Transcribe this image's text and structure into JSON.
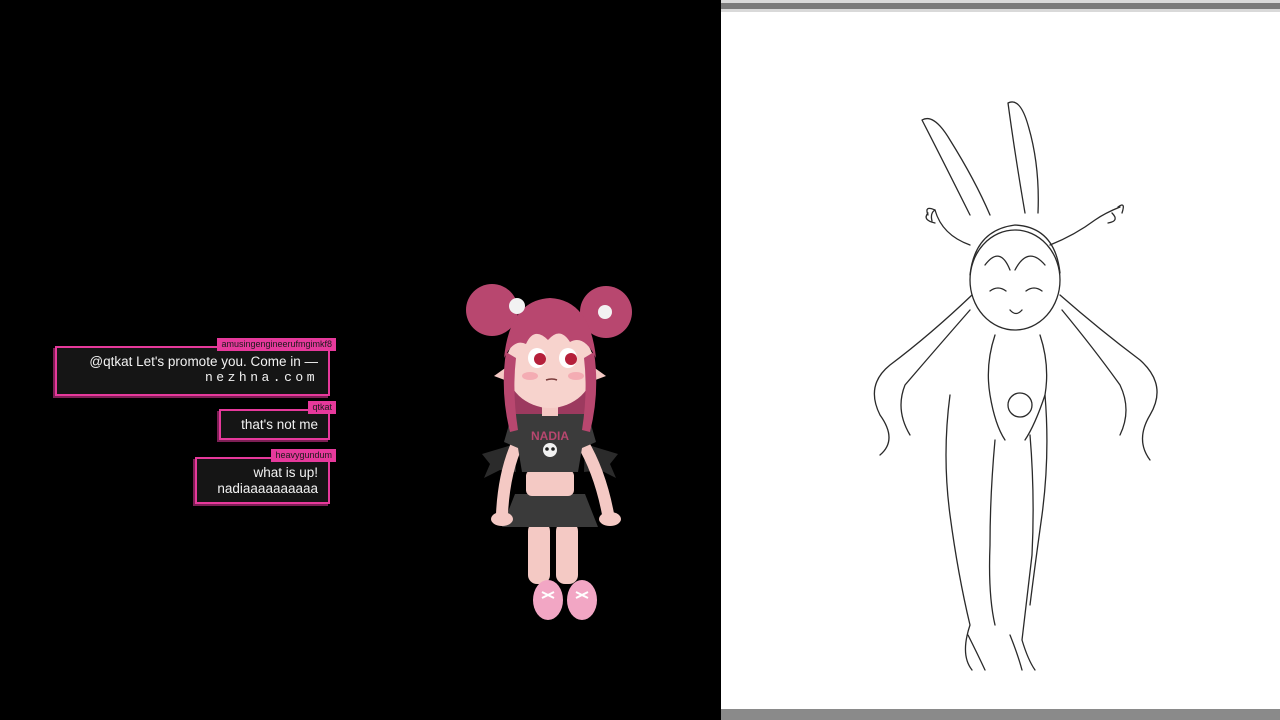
{
  "chat": {
    "messages": [
      {
        "username": "amusingengineerufmgimkf8",
        "text": "@qtkat Let's promote you. Come in —",
        "link": "nezhna.com"
      },
      {
        "username": "qtkat",
        "text": "that's not me"
      },
      {
        "username": "heavygundum",
        "text": "what is up!\nnadiaaaaaaaaaa"
      }
    ]
  },
  "avatar": {
    "shirt_text": "NADIA",
    "icon": "skull-icon"
  },
  "colors": {
    "background": "#000000",
    "chat_accent": "#e6399b",
    "chat_bubble": "#151515",
    "chat_text": "#f2f2f2",
    "canvas": "#ffffff",
    "hair": "#b8476f",
    "sketch_line": "#2a2a2a"
  }
}
